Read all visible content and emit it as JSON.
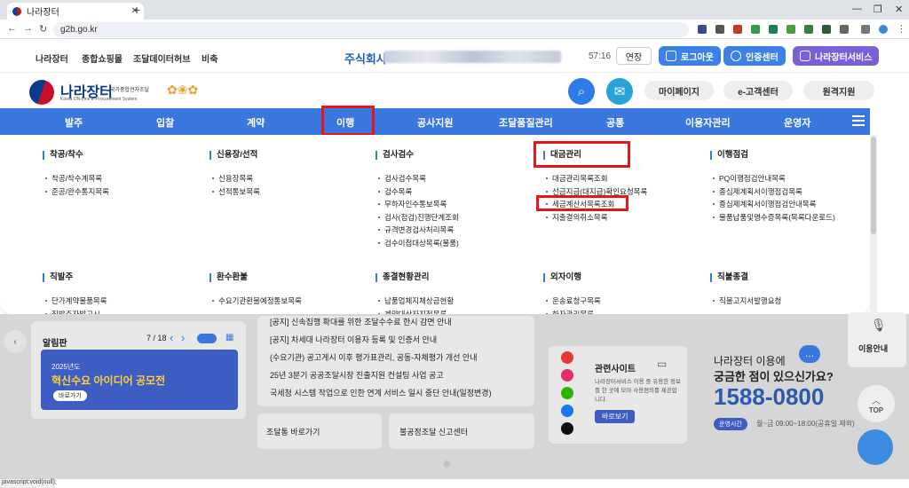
{
  "browser": {
    "tab_title": "나라장터",
    "url": "g2b.go.kr",
    "status": "javascript:void(null);"
  },
  "topnav": {
    "items": [
      "나라장터",
      "종합쇼핑몰",
      "조달데이터허브",
      "비축"
    ],
    "company": "주식회사",
    "timer": "57:16",
    "extend": "연장",
    "logout": "로그아웃",
    "cert": "인증센터",
    "services": "나라장터서비스"
  },
  "logo": {
    "name": "나라장터",
    "sub": "국가종합전자조달",
    "eng": "Korea ON-Line E-Procurement System"
  },
  "header_buttons": [
    "마이페이지",
    "e-고객센터",
    "원격지원"
  ],
  "mainnav": [
    "발주",
    "입찰",
    "계약",
    "이행",
    "공사지원",
    "조달품질관리",
    "공통",
    "이용자관리",
    "운영자"
  ],
  "menu": [
    {
      "title": "착공/착수",
      "items": [
        "착공/착수계목록",
        "준공/완수통지목록"
      ]
    },
    {
      "title": "신용장/선적",
      "items": [
        "신용장목록",
        "선적통보목록"
      ]
    },
    {
      "title": "검사검수",
      "items": [
        "검사검수목록",
        "검수목록",
        "무하자인수통보목록",
        "검사(점검)진행단계조회",
        "규격변경검사처리목록",
        "검수이첩대상목록(물품)"
      ]
    },
    {
      "title": "대금관리",
      "items": [
        "대금관리목록조회",
        "선금지급(대지급)확인요청목록",
        "세금계산서목록조회",
        "지출결의취소목록"
      ]
    },
    {
      "title": "이행점검",
      "items": [
        "PQ이행점검안내목록",
        "종심제계획서이행점검목록",
        "종심제계획서이행점검안내목록",
        "물품납품및영수증목록(목록다운로드)"
      ]
    },
    {
      "title": "직발주",
      "items": [
        "단가계약물품목록",
        "직발주자발고시"
      ]
    },
    {
      "title": "환수환불",
      "items": [
        "수요기관환불예정통보목록"
      ]
    },
    {
      "title": "종결현황관리",
      "items": [
        "납품업체지체상금현황",
        "계약대상자지정목록"
      ]
    },
    {
      "title": "외자이행",
      "items": [
        "운송료청구목록",
        "하자관리목록"
      ]
    },
    {
      "title": "직불종결",
      "items": [
        "직불고지서발행요청"
      ]
    }
  ],
  "lower": {
    "notice_title": "알림판",
    "pager": "7 / 18",
    "banner_year": "2025년도",
    "banner_title": "혁신수요 아이디어 공모전",
    "banner_btn": "바로가기",
    "news": [
      "[공지] 신속집행 확대를 위한 조달수수료 한시 감면 안내",
      "[공지] 차세대 나라장터 이용자 등록 및 인증서 안내",
      "(수요기관) 공고게시 이후 평가표관리, 공동-자체평가 개선 안내",
      "25년 3분기 공공조달시장 진출지원 컨설팅 사업 공고",
      "국세청 시스템 작업으로 인한 연계 서비스 일시 중단 안내(일정변경)"
    ],
    "quick1": "조달통 바로가기",
    "quick2": "불공정조달 신고센터",
    "related_title": "관련사이트",
    "related_desc": "나라장터서비스 이용 중 유용한 정보를 한 곳에 모아 사용편의를 제공합니다.",
    "related_btn": "바로보기",
    "call_q1": "나라장터 이용에",
    "call_q2": "궁금한 점이 있으신가요?",
    "phone": "1588-0800",
    "hours_label": "운영시간",
    "hours": "월~금 09:00~18:00(공휴일 제외)",
    "side_voice": "이용안내",
    "side_top": "TOP"
  },
  "colors": {
    "nav": "#3a78e0",
    "highlight": "#e8141c",
    "brand": "#0b3a8c"
  }
}
